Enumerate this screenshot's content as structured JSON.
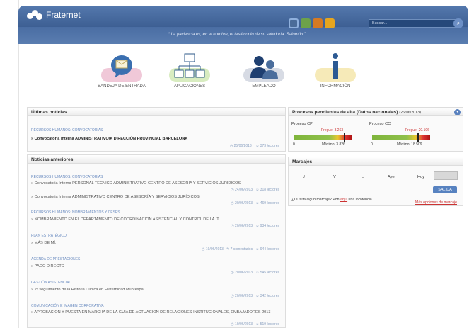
{
  "brand": {
    "name": "Fraternet"
  },
  "quote": "“ La paciencia es, en el hombre, el testimonio de su sabiduría. Salomón ”",
  "search": {
    "placeholder": "Buscar..."
  },
  "colors": {
    "header": "#4a6da3",
    "accent": "#5782c0",
    "link": "#6b8cc0",
    "bar_green": "#7fb53c",
    "bar_yellow": "#e8c830",
    "bar_red": "#d33"
  },
  "tiles": [
    {
      "label": "BANDEJA DE ENTRADA",
      "icon": "inbox-envelope-icon"
    },
    {
      "label": "APLICACIONES",
      "icon": "network-icon"
    },
    {
      "label": "EMPLEADO",
      "icon": "employees-icon"
    },
    {
      "label": "INFORMACIÓN",
      "icon": "info-icon"
    }
  ],
  "news": {
    "title": "Últimas noticias",
    "category": "RECURSOS HUMANOS: CONVOCATORIAS",
    "headline": "» Convocatoria Interna ADMINISTRATIVO/A DIRECCIÓN PROVINCIAL BARCELONA",
    "date": "25/06/2013",
    "readers": "373 lectores"
  },
  "older": {
    "title": "Noticias anteriores",
    "items": [
      {
        "cat": "RECURSOS HUMANOS: CONVOCATORIAS",
        "title": "» Convocatoria Interna PERSONAL TÉCNICO ADMINISTRATIVO CENTRO DE ASESORÍA Y SERVICIOS JURÍDICOS",
        "date": "24/06/2013",
        "readers": "318 lectores"
      },
      {
        "cat": "",
        "title": "» Convocatoria Interna ADMINISTRATIVO CENTRO DE ASESORÍA Y SERVICIOS JURÍDICOS",
        "date": "20/06/2013",
        "readers": "469 lectores"
      },
      {
        "cat": "RECURSOS HUMANOS: NOMBRAMIENTOS Y CESES",
        "title": "» NOMBRAMIENTO EN EL DEPARTAMENTO DE COORDINACIÓN ASISTENCIAL Y CONTROL DE LA IT",
        "date": "20/06/2013",
        "readers": "934 lectores"
      },
      {
        "cat": "PLAN ESTRATÉGICO",
        "title": "» MÁS DE MÍ.",
        "date": "19/06/2013",
        "comments": "7 comentarios",
        "readers": "944 lectores"
      },
      {
        "cat": "AGENDA DE PRESTACIONES",
        "title": "» PAGO DIRECTO",
        "date": "20/06/2013",
        "readers": "545 lectores"
      },
      {
        "cat": "GESTIÓN ASISTENCIAL",
        "title": "» 2º seguimiento de la Historia Clínica en Fraternidad Muprespa",
        "date": "20/06/2013",
        "readers": "342 lectores"
      },
      {
        "cat": "COMUNICACIÓN E IMAGEN CORPORATIVA",
        "title": "» APROBACIÓN Y PUESTA EN MARCHA DE LA GUÍA DE ACTUACIÓN DE RELACIONES INSTITUCIONALES, EMBAJADORES 2013",
        "date": "19/06/2013",
        "readers": "519 lectores"
      }
    ]
  },
  "pending": {
    "title": "Procesos pendientes de alta (Datos nacionales)",
    "date": "(26/06/2013)",
    "cp": {
      "label": "Proceso CP",
      "target_label": "Fregue: 3.263",
      "min": "0",
      "max_label": "Máximo: 3.826",
      "fraction": 0.85
    },
    "cc": {
      "label": "Proceso CC",
      "target_label": "Fregue: 20.106",
      "min": "0",
      "max_label": "Máximo: 18.509",
      "fraction": 0.78
    }
  },
  "marcajes": {
    "title": "Marcajes",
    "days": [
      "J",
      "V",
      "L",
      "Ayer",
      "Hoy"
    ],
    "button": "SALIDA",
    "question": "¿Te falta algún marcaje? Pon",
    "link": "aquí",
    "question_end": "una incidencia",
    "more": "Más opciones de marcaje"
  }
}
